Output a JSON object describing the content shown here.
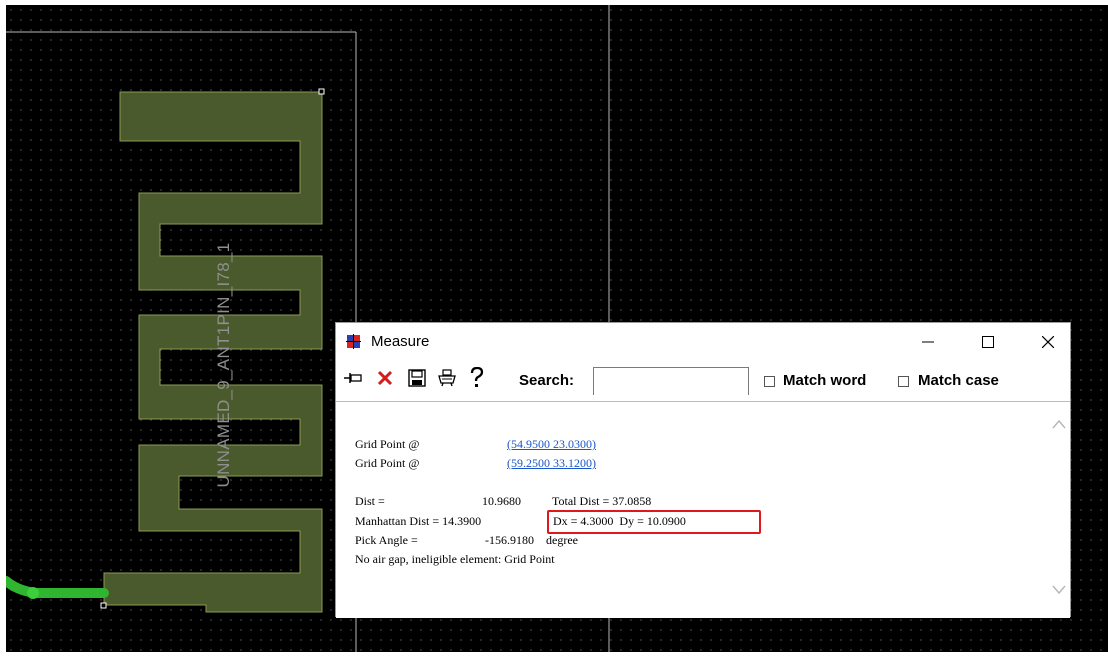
{
  "canvas": {
    "ref_designator": "UNNAMED_9_ANT1PIN_I78_1",
    "trace_color": "#4a5a2c",
    "trace_outline": "#8a9a55",
    "route_color": "#2fb52f"
  },
  "dialog": {
    "title": "Measure",
    "toolbar": {
      "pin_icon": "pin-icon",
      "clear_icon": "delete-x-icon",
      "save_icon": "save-icon",
      "print_icon": "print-icon",
      "help_icon": "help-icon"
    },
    "search": {
      "label": "Search:",
      "value": ""
    },
    "match_word": {
      "label": "Match word",
      "checked": false
    },
    "match_case": {
      "label": "Match case",
      "checked": false
    },
    "results": {
      "grid1_label": "Grid Point @",
      "grid1_value": "(54.9500 23.0300)",
      "grid2_label": "Grid Point @",
      "grid2_value": "(59.2500 33.1200)",
      "dist_label": "Dist =",
      "dist_value": "10.9680",
      "total_dist": "Total Dist = 37.0858",
      "manhattan": "Manhattan Dist = 14.3900",
      "dxdy": "Dx = 4.3000  Dy = 10.0900",
      "pick_angle_label": "Pick Angle =",
      "pick_angle_value": "-156.9180",
      "pick_angle_unit": "degree",
      "note": "No air gap, ineligible element: Grid Point"
    },
    "highlight_color": "#e0171b"
  }
}
